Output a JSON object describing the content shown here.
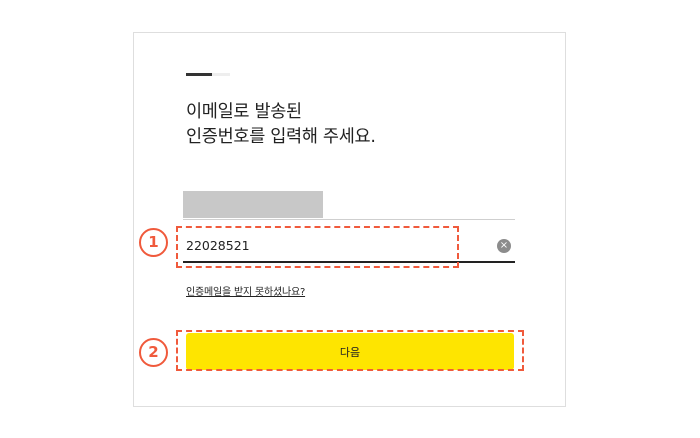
{
  "progress": {
    "value": 0.6
  },
  "heading": {
    "line1": "이메일로 발송된",
    "line2": "인증번호를 입력해 주세요."
  },
  "email": {
    "masked": true
  },
  "code_input": {
    "value": "22028521",
    "clear_icon": "×"
  },
  "resend_link": "인증메일을 받지 못하셨나요?",
  "next_button": "다음",
  "annotations": {
    "marker_1": "1",
    "marker_2": "2",
    "color": "#f05a3c"
  },
  "colors": {
    "primary_button": "#fee500",
    "mask": "#c8c8c8"
  }
}
